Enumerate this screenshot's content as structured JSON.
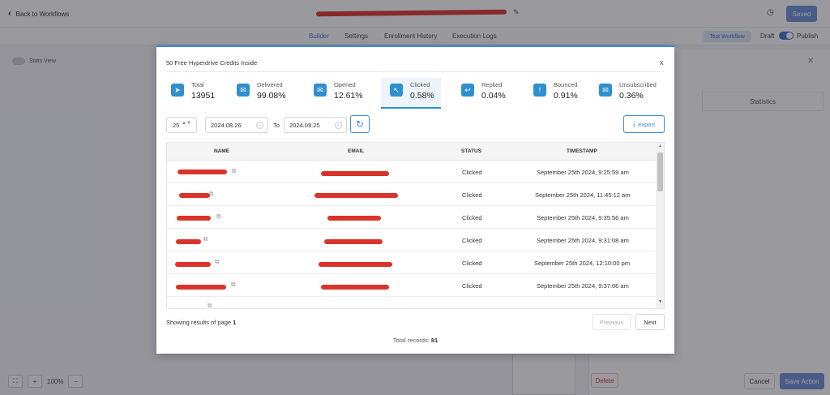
{
  "app": {
    "back_label": "Back to Workflows",
    "save_label": "Saved",
    "tabs": [
      "Builder",
      "Settings",
      "Enrollment History",
      "Execution Logs"
    ],
    "test_workflow_label": "Test Workflow",
    "draft_label": "Draft",
    "publish_label": "Publish",
    "stats_view_label": "Stats View",
    "statistics_tab_label": "Statistics",
    "delete_label": "Delete",
    "cancel_label": "Cancel",
    "save_action_label": "Save Action",
    "zoom_level": "100%"
  },
  "modal": {
    "title": "50 Free Hyperdrive Credits Inside",
    "close_label": "x",
    "stats": [
      {
        "label": "Total",
        "value": "13951",
        "icon": "send-icon"
      },
      {
        "label": "Delivered",
        "value": "99.08%",
        "icon": "delivered-icon"
      },
      {
        "label": "Opened",
        "value": "12.61%",
        "icon": "opened-mail-icon"
      },
      {
        "label": "Clicked",
        "value": "0.58%",
        "icon": "cursor-click-icon",
        "active": true
      },
      {
        "label": "Replied",
        "value": "0.04%",
        "icon": "reply-icon"
      },
      {
        "label": "Bounced",
        "value": "0.91%",
        "icon": "alert-icon"
      },
      {
        "label": "Unsubscribed",
        "value": "0.36%",
        "icon": "unsubscribe-icon"
      }
    ],
    "per_page": "25",
    "date_from": "2024.08.26",
    "to_label": "To",
    "date_to": "2024.09.25",
    "export_label": "export",
    "columns": [
      "NAME",
      "EMAIL",
      "STATUS",
      "TIMESTAMP"
    ],
    "rows": [
      {
        "status": "Clicked",
        "timestamp": "September 25th 2024, 9:25:59 am"
      },
      {
        "status": "Clicked",
        "timestamp": "September 25th 2024, 11:45:12 am"
      },
      {
        "status": "Clicked",
        "timestamp": "September 25th 2024, 9:35:56 am"
      },
      {
        "status": "Clicked",
        "timestamp": "September 25th 2024, 9:31:08 am"
      },
      {
        "status": "Clicked",
        "timestamp": "September 25th 2024, 12:10:00 pm"
      },
      {
        "status": "Clicked",
        "timestamp": "September 25th 2024, 9:37:06 am"
      }
    ],
    "showing_prefix": "Showing results of page",
    "page": "1",
    "previous_label": "Previous",
    "next_label": "Next",
    "total_prefix": "Total records:",
    "total_records": "81"
  },
  "colors": {
    "accent": "#2f8fcf",
    "redaction": "#d9342b",
    "primary_button": "#6c8fd8"
  }
}
